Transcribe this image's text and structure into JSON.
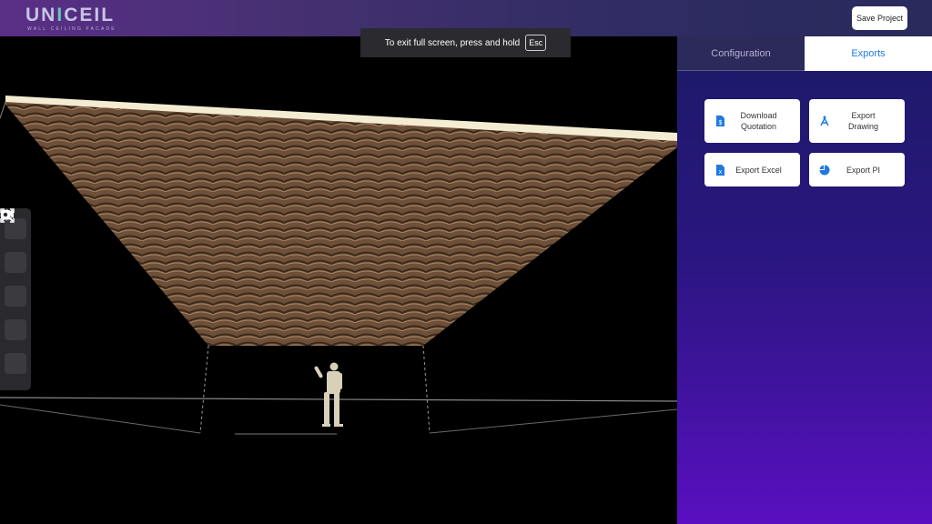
{
  "header": {
    "logo_main": "UNICEIL",
    "logo_part1": "UN",
    "logo_accent": "I",
    "logo_part2": "CEIL",
    "tagline": "WALL CEILING FACADE",
    "save_label": "Save Project"
  },
  "fullscreen_notice": {
    "text": "To exit full screen, press and hold",
    "key": "Esc"
  },
  "toolbar": {
    "tools": [
      "fit-view-icon",
      "3d-cube-icon",
      "expand-icon",
      "focus-icon",
      "video-camera-icon"
    ]
  },
  "panel": {
    "tabs": [
      {
        "label": "Configuration",
        "active": false
      },
      {
        "label": "Exports",
        "active": true
      }
    ],
    "exports": [
      {
        "line1": "Download",
        "line2": "Quotation",
        "icon": "document-dollar-icon"
      },
      {
        "line1": "Export",
        "line2": "Drawing",
        "icon": "drafting-compass-icon"
      },
      {
        "line1": "Export Excel",
        "line2": "",
        "icon": "excel-file-icon"
      },
      {
        "line1": "Export PI",
        "line2": "",
        "icon": "pie-chart-icon"
      }
    ]
  },
  "colors": {
    "accent": "#1f7ae0",
    "logo_accent": "#69c7b8",
    "panel_top": "#1c1a66",
    "panel_bottom": "#5a0fc0"
  }
}
